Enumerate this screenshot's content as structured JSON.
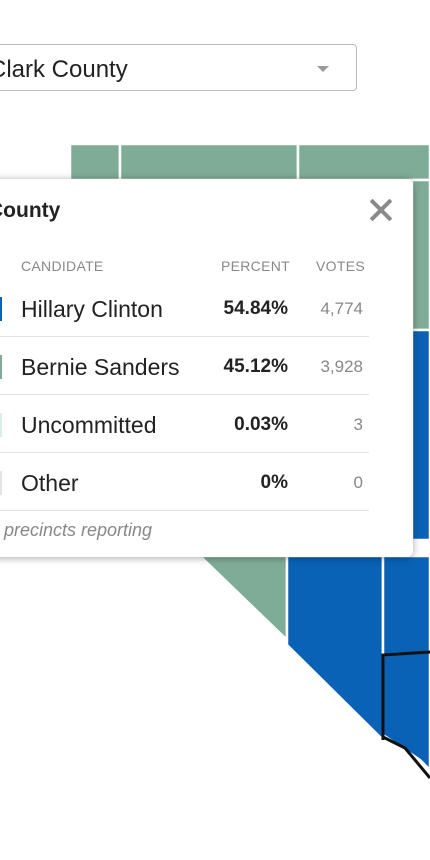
{
  "county_selector": {
    "selected": "Clark County",
    "icon": "chevron-down-icon"
  },
  "colors": {
    "clinton": "#0a62b6",
    "sanders": "#7fac96",
    "uncommitted": "#d9eee6",
    "other": "#e4e4e4",
    "county_border": "#ffffff",
    "selected_outline": "#111111"
  },
  "popup": {
    "title": "County",
    "close_icon": "close-icon",
    "headers": {
      "candidate": "CANDIDATE",
      "percent": "PERCENT",
      "votes": "VOTES"
    },
    "rows": [
      {
        "candidate": "Hillary Clinton",
        "percent": "54.84%",
        "votes": "4,774",
        "swatch": "#0a62b6"
      },
      {
        "candidate": "Bernie Sanders",
        "percent": "45.12%",
        "votes": "3,928",
        "swatch": "#7fac96"
      },
      {
        "candidate": "Uncommitted",
        "percent": "0.03%",
        "votes": "3",
        "swatch": "#d9eee6"
      },
      {
        "candidate": "Other",
        "percent": "0%",
        "votes": "0",
        "swatch": "#e4e4e4"
      }
    ],
    "precincts_text": "precincts reporting"
  }
}
